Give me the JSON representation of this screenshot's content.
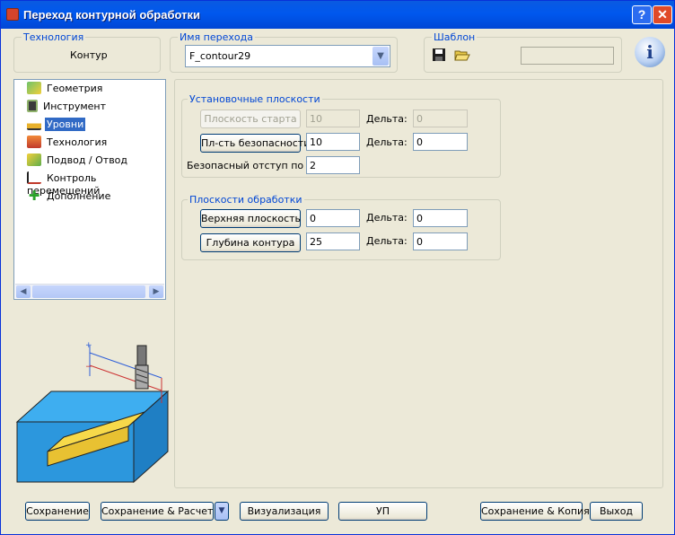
{
  "window": {
    "title": "Переход контурной обработки",
    "help_label": "?",
    "close_label": "✕"
  },
  "header": {
    "technology_legend": "Технология",
    "technology_value": "Контур",
    "name_legend": "Имя перехода",
    "name_value": "F_contour29",
    "template_legend": "Шаблон",
    "template_value": ""
  },
  "tree": {
    "items": [
      {
        "label": "Геометрия",
        "icon": "geometry-icon"
      },
      {
        "label": "Инструмент",
        "icon": "tool-icon"
      },
      {
        "label": "Уровни",
        "icon": "levels-icon",
        "selected": true
      },
      {
        "label": "Технология",
        "icon": "technology-icon"
      },
      {
        "label": "Подвод / Отвод",
        "icon": "approach-icon"
      },
      {
        "label": "Контроль перемещений",
        "icon": "motion-control-icon"
      },
      {
        "label": "Дополнение",
        "icon": "addition-icon"
      }
    ]
  },
  "setup_planes": {
    "legend": "Установочные плоскости",
    "start_plane": {
      "button": "Плоскость старта",
      "value": "10",
      "delta_label": "Дельта:",
      "delta": "0",
      "enabled": false
    },
    "safety_plane": {
      "button": "Пл-сть безопасности",
      "value": "10",
      "delta_label": "Дельта:",
      "delta": "0",
      "enabled": true
    },
    "safe_offset": {
      "label": "Безопасный отступ по Z:",
      "value": "2"
    }
  },
  "machining_planes": {
    "legend": "Плоскости обработки",
    "top_plane": {
      "button": "Верхняя плоскость",
      "value": "0",
      "delta_label": "Дельта:",
      "delta": "0"
    },
    "depth": {
      "button": "Глубина контура",
      "value": "25",
      "delta_label": "Дельта:",
      "delta": "0"
    }
  },
  "preview_labels": {
    "plus": "+",
    "minus": "−"
  },
  "footer": {
    "save": "Сохранение",
    "save_calc": "Сохранение & Расчет",
    "save_calc_arrow": "▼",
    "visualize": "Визуализация",
    "nc": "УП",
    "save_copy": "Сохранение & Копия",
    "exit": "Выход"
  }
}
